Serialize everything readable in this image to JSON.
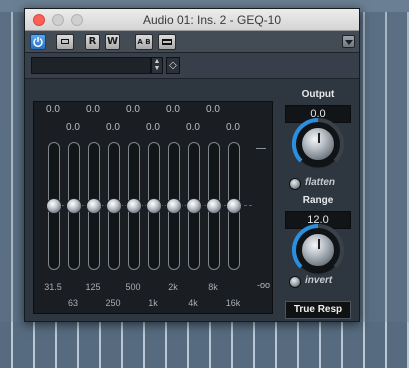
{
  "window": {
    "title": "Audio 01: Ins. 2 - GEQ-10"
  },
  "toolbar": {
    "power_icon": "power-icon",
    "bypass_icon": "bypass-icon",
    "read_label": "R",
    "write_label": "W",
    "ab_label": "A B",
    "preset_icon": "preset-icon",
    "menu_icon": "chevron-down-icon"
  },
  "preset": {
    "name": "",
    "spin_up": "▲",
    "spin_down": "▼",
    "store_icon": "◇"
  },
  "eq": {
    "top_values": [
      "0.0",
      "0.0",
      "0.0",
      "0.0",
      "0.0"
    ],
    "second_values": [
      "0.0",
      "0.0",
      "0.0",
      "0.0",
      "0.0"
    ],
    "band_gains": [
      0,
      0,
      0,
      0,
      0,
      0,
      0,
      0,
      0,
      0
    ],
    "min_label": "-oo",
    "freq_top": [
      "31.5",
      "125",
      "500",
      "2k",
      "8k"
    ],
    "freq_bottom": [
      "63",
      "250",
      "1k",
      "4k",
      "16k"
    ]
  },
  "output": {
    "label": "Output",
    "value": "0.0",
    "flatten_label": "flatten"
  },
  "range": {
    "label": "Range",
    "value": "12.0",
    "invert_label": "invert"
  },
  "mode_button": {
    "label": "True Resp"
  },
  "colors": {
    "accent": "#2b8fe0",
    "panel": "#1a1e22",
    "power_on": "#3a8ae0"
  }
}
